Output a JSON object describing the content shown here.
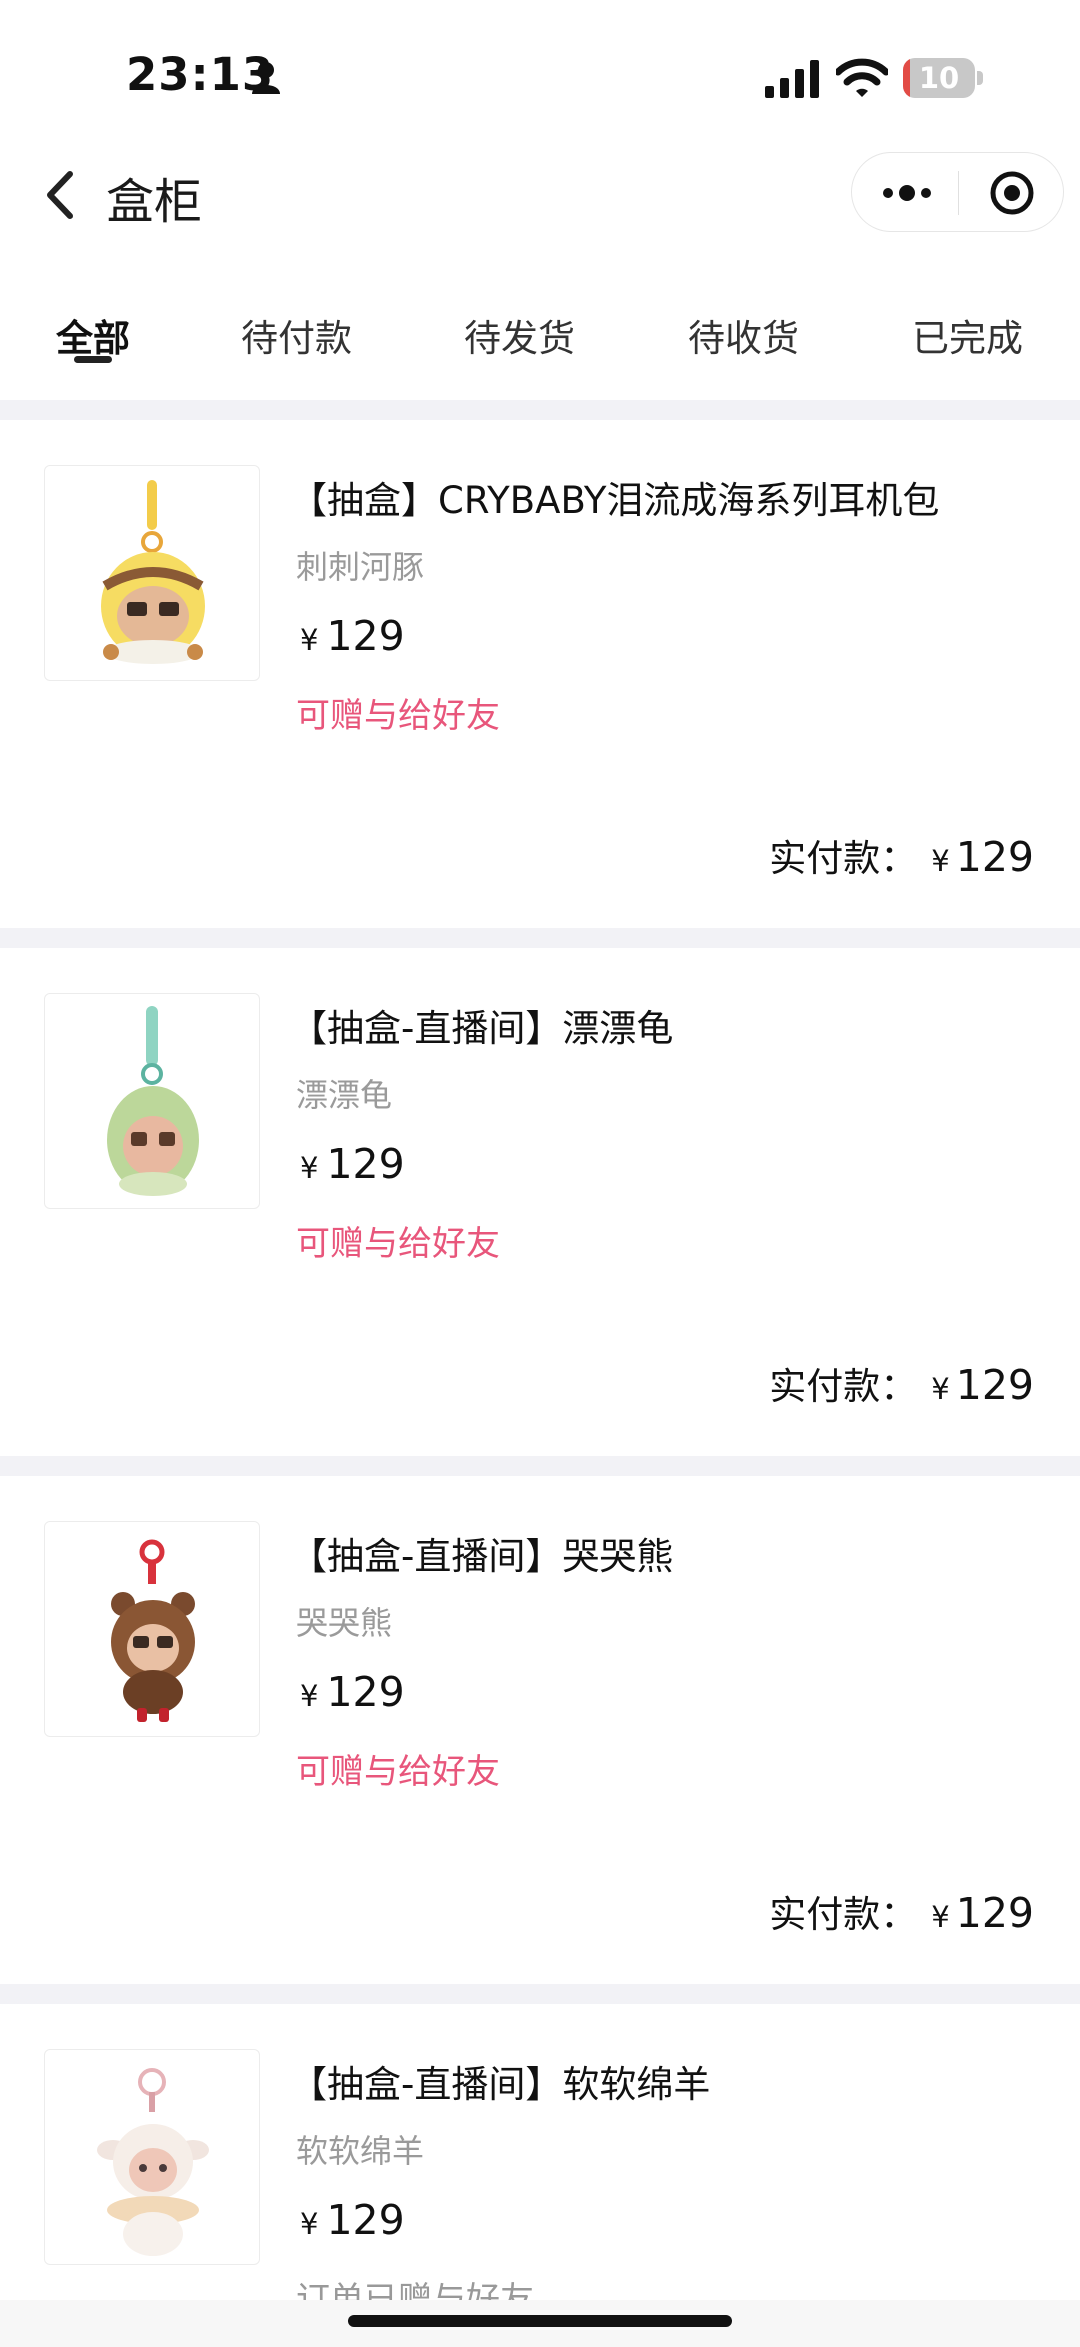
{
  "status_bar": {
    "time": "23:13",
    "battery": "10",
    "battery_level": 0.1
  },
  "nav": {
    "title": "盒柜"
  },
  "tabs": [
    {
      "label": "全部",
      "active": true
    },
    {
      "label": "待付款"
    },
    {
      "label": "待发货"
    },
    {
      "label": "待收货"
    },
    {
      "label": "已完成"
    }
  ],
  "orders": [
    {
      "title": "【抽盒】CRYBABY泪流成海系列耳机包",
      "variant": "刺刺河豚",
      "currency": "¥",
      "price": "129",
      "gift_text": "可赠与给好友",
      "paid_label": "实付款：",
      "paid_amount": "129"
    },
    {
      "title": "【抽盒-直播间】漂漂龟",
      "variant": "漂漂龟",
      "currency": "¥",
      "price": "129",
      "gift_text": "可赠与给好友",
      "paid_label": "实付款：",
      "paid_amount": "129"
    },
    {
      "title": "【抽盒-直播间】哭哭熊",
      "variant": "哭哭熊",
      "currency": "¥",
      "price": "129",
      "gift_text": "可赠与给好友",
      "paid_label": "实付款：",
      "paid_amount": "129"
    },
    {
      "title": "【抽盒-直播间】软软绵羊",
      "variant": "软软绵羊",
      "currency": "¥",
      "price": "129",
      "gift_text": "订单已赠与好友"
    }
  ],
  "colors": {
    "accent_pink": "#e8567b",
    "battery_low": "#e24b45",
    "separator": "#f2f2f6"
  }
}
